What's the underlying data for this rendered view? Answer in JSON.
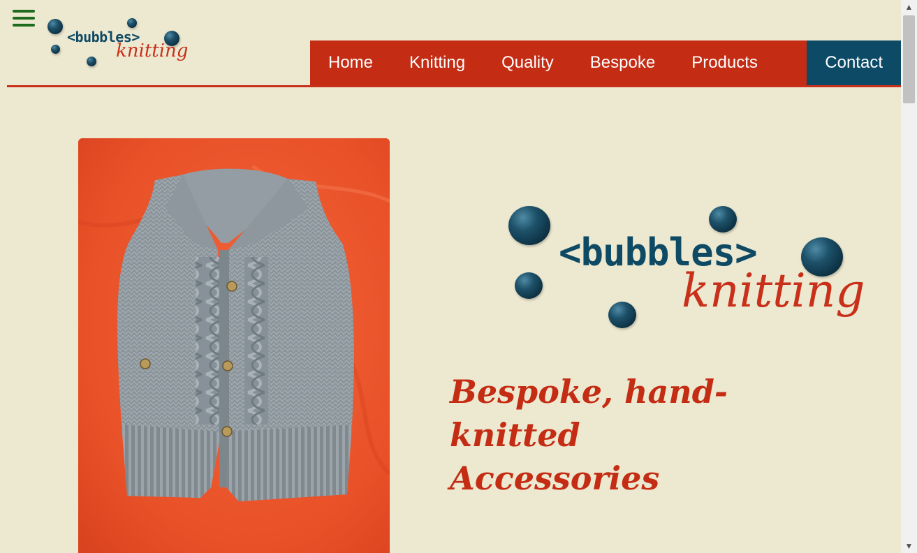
{
  "brand": {
    "word": "<bubbles>",
    "script": "knitting"
  },
  "icons": {
    "menu": "hamburger-menu-icon",
    "scroll_up": "chevron-up-icon",
    "scroll_down": "chevron-down-icon"
  },
  "nav": {
    "items": [
      {
        "label": "Home"
      },
      {
        "label": "Knitting"
      },
      {
        "label": "Quality"
      },
      {
        "label": "Bespoke"
      },
      {
        "label": "Products"
      },
      {
        "label": "Contact"
      }
    ],
    "active": "Contact"
  },
  "hero": {
    "tagline_line1": "Bespoke, hand-knitted",
    "tagline_line2": "Accessories"
  },
  "colors": {
    "background": "#ede8d0",
    "nav_red": "#c42c14",
    "nav_active_blue": "#0d4a66",
    "brand_blue": "#0e4a64",
    "brand_red": "#c8301a",
    "menu_green": "#1e6b1e"
  }
}
